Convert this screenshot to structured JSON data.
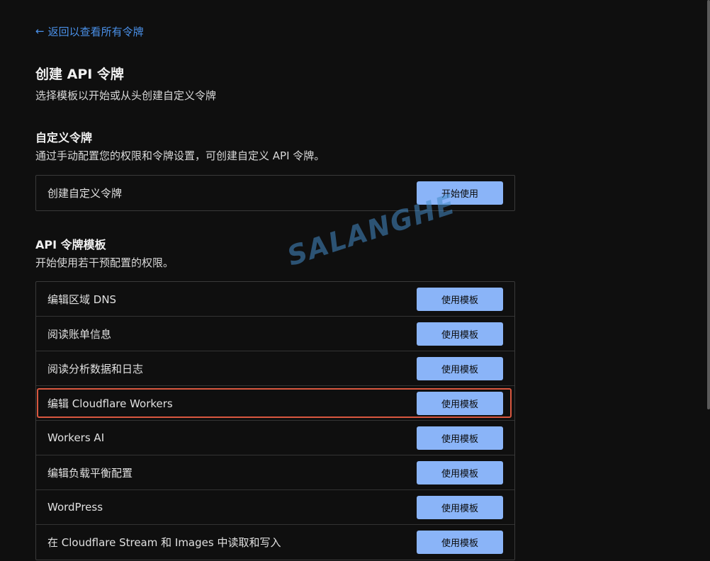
{
  "back_link": {
    "label": "返回以查看所有令牌"
  },
  "page": {
    "title": "创建 API 令牌",
    "subtitle": "选择模板以开始或从头创建自定义令牌"
  },
  "custom_section": {
    "title": "自定义令牌",
    "description": "通过手动配置您的权限和令牌设置，可创建自定义 API 令牌。",
    "row_label": "创建自定义令牌",
    "button_label": "开始使用"
  },
  "templates_section": {
    "title": "API 令牌模板",
    "description": "开始使用若干预配置的权限。",
    "button_label": "使用模板",
    "rows": [
      {
        "label": "编辑区域 DNS"
      },
      {
        "label": "阅读账单信息"
      },
      {
        "label": "阅读分析数据和日志"
      },
      {
        "label": "编辑 Cloudflare Workers"
      },
      {
        "label": "Workers AI"
      },
      {
        "label": "编辑负载平衡配置"
      },
      {
        "label": "WordPress"
      },
      {
        "label": "在 Cloudflare Stream 和 Images 中读取和写入"
      }
    ]
  },
  "watermark": "SALANGHE",
  "colors": {
    "background": "#0f0f0f",
    "link": "#4a90e8",
    "button": "#8ab4f8",
    "highlight": "#d9573f"
  },
  "icons": {
    "back": "arrow-left-icon"
  }
}
